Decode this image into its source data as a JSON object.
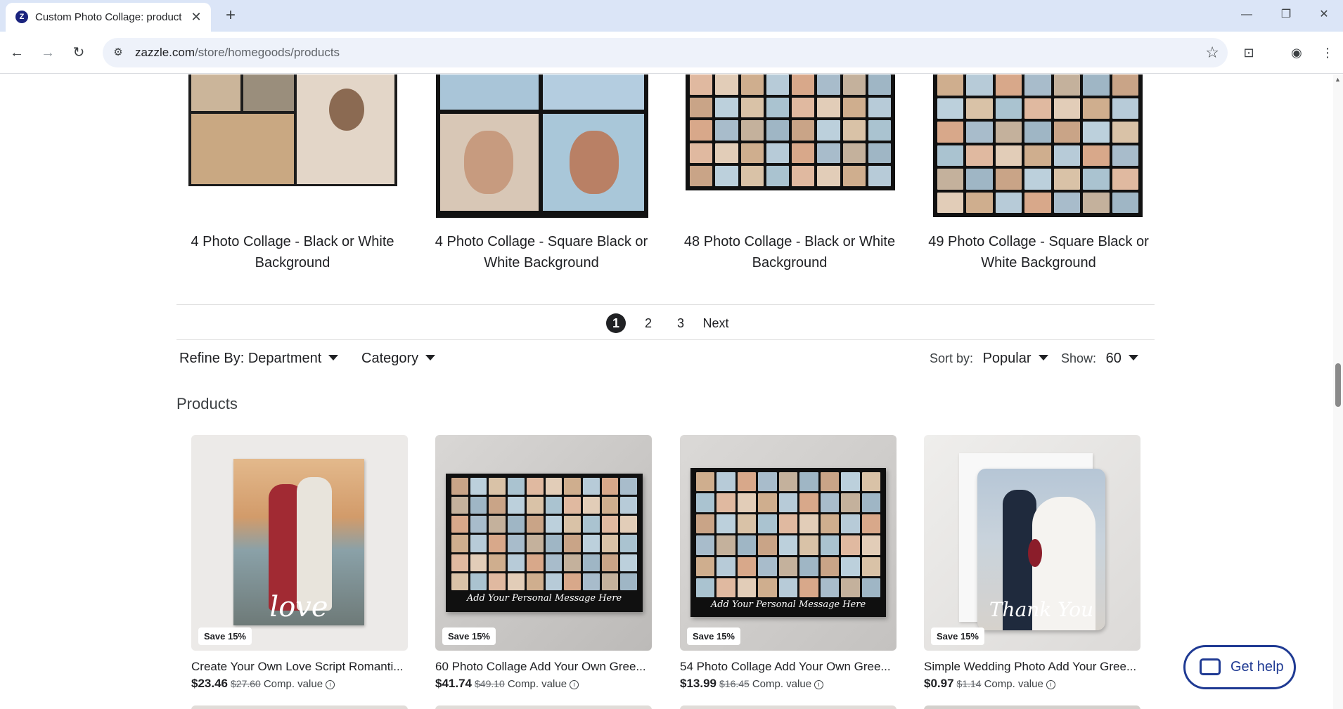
{
  "browser": {
    "tab_title": "Custom Photo Collage: product",
    "favicon_letter": "Z",
    "url_host": "zazzle.com",
    "url_path": "/store/homegoods/products"
  },
  "top_products": [
    {
      "title": "4 Photo Collage - Black or White Background"
    },
    {
      "title": "4 Photo Collage - Square Black or White Background"
    },
    {
      "title": "48 Photo Collage - Black or White Background"
    },
    {
      "title": "49 Photo Collage - Square Black or White Background"
    }
  ],
  "pagination": {
    "pages": [
      "1",
      "2",
      "3"
    ],
    "active": "1",
    "next_label": "Next"
  },
  "filters": {
    "refine_label": "Refine By: Department",
    "category_label": "Category",
    "sort_label": "Sort by:",
    "sort_value": "Popular",
    "show_label": "Show:",
    "show_value": "60"
  },
  "section_title": "Products",
  "products": [
    {
      "title": "Create Your Own Love Script Romanti...",
      "badge": "Save 15%",
      "price": "$23.46",
      "original_price": "$27.60",
      "comp_label": "Comp. value",
      "overlay_text": "love"
    },
    {
      "title": "60 Photo Collage Add Your Own Gree...",
      "badge": "Save 15%",
      "price": "$41.74",
      "original_price": "$49.10",
      "comp_label": "Comp. value",
      "overlay_text": "Add Your Personal Message Here"
    },
    {
      "title": "54 Photo Collage Add Your Own Gree...",
      "badge": "Save 15%",
      "price": "$13.99",
      "original_price": "$16.45",
      "comp_label": "Comp. value",
      "overlay_text": "Add Your Personal Message Here"
    },
    {
      "title": "Simple Wedding Photo Add Your Gree...",
      "badge": "Save 15%",
      "price": "$0.97",
      "original_price": "$1.14",
      "comp_label": "Comp. value",
      "overlay_text": "Thank You"
    }
  ],
  "help_button": {
    "label": "Get help"
  },
  "icons": {
    "back": "arrow-left-icon",
    "forward": "arrow-right-icon",
    "reload": "reload-icon",
    "site_info": "tune-icon",
    "bookmark": "star-icon",
    "chat": "chat-bubble-icon"
  },
  "colors": {
    "tab_strip": "#dbe5f7",
    "help_accent": "#1f3a93",
    "text": "#202124"
  }
}
